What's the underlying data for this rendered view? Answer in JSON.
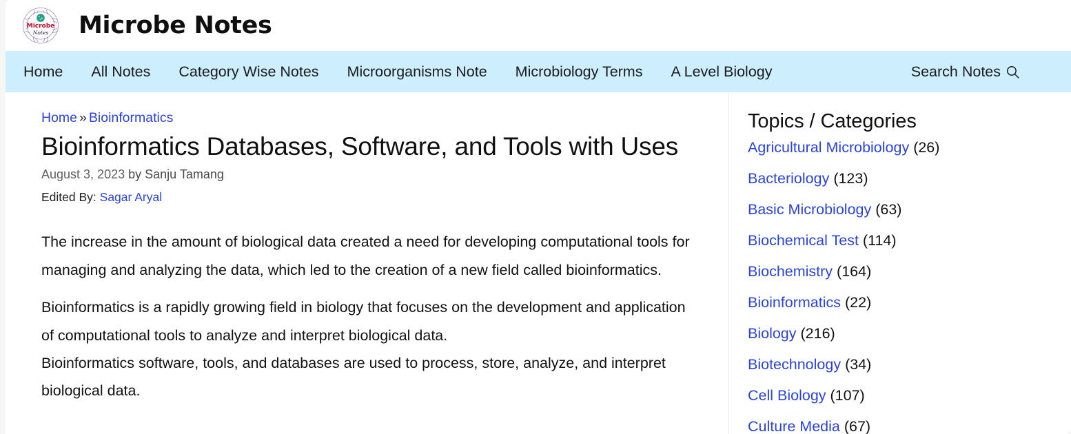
{
  "site": {
    "title": "Microbe Notes",
    "logo": {
      "word_top": "Microbe",
      "word_bottom": "Notes",
      "accent_red": "#c8102e",
      "accent_teal": "#1fa08c",
      "ring_color": "#7a5f9e"
    }
  },
  "nav": {
    "items": [
      {
        "label": "Home"
      },
      {
        "label": "All Notes"
      },
      {
        "label": "Category Wise Notes"
      },
      {
        "label": "Microorganisms Note"
      },
      {
        "label": "Microbiology Terms"
      },
      {
        "label": "A Level Biology"
      }
    ],
    "search_label": "Search Notes",
    "search_icon": "magnifier-icon",
    "background": "#cdeefd"
  },
  "breadcrumb": {
    "home": "Home",
    "separator": "»",
    "current": "Bioinformatics"
  },
  "article": {
    "title": "Bioinformatics Databases, Software, and Tools with Uses",
    "date": "August 3, 2023",
    "by_prefix": "by",
    "author": "Sanju Tamang",
    "edited_label": "Edited By:",
    "editor": "Sagar Aryal",
    "paragraphs": [
      "The increase in the amount of biological data created a need for developing computational tools for managing and analyzing the data, which led to the creation of a new field called bioinformatics.",
      "Bioinformatics is a rapidly growing field in biology that focuses on the development and application of computational tools to analyze and interpret biological data.",
      "Bioinformatics software, tools, and databases are used to process, store, analyze, and interpret biological data."
    ]
  },
  "sidebar": {
    "title": "Topics / Categories",
    "categories": [
      {
        "label": "Agricultural Microbiology",
        "count": "(26)"
      },
      {
        "label": "Bacteriology",
        "count": "(123)"
      },
      {
        "label": "Basic Microbiology",
        "count": "(63)"
      },
      {
        "label": "Biochemical Test",
        "count": "(114)"
      },
      {
        "label": "Biochemistry",
        "count": "(164)"
      },
      {
        "label": "Bioinformatics",
        "count": "(22)"
      },
      {
        "label": "Biology",
        "count": "(216)"
      },
      {
        "label": "Biotechnology",
        "count": "(34)"
      },
      {
        "label": "Cell Biology",
        "count": "(107)"
      },
      {
        "label": "Culture Media",
        "count": "(67)"
      }
    ],
    "link_color": "#2b44dd"
  }
}
